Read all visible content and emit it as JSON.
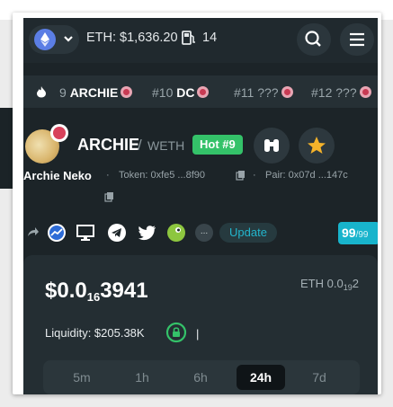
{
  "header": {
    "eth_price": "ETH: $1,636.20",
    "gas": "14"
  },
  "ticker": [
    {
      "rank": "9",
      "symbol": "ARCHIE",
      "dim": false
    },
    {
      "rank": "#10",
      "symbol": "DC",
      "dim": false
    },
    {
      "rank": "#11",
      "symbol": "???",
      "dim": true
    },
    {
      "rank": "#12",
      "symbol": "???",
      "dim": true
    }
  ],
  "token": {
    "symbol": "ARCHIE",
    "slash": "/",
    "pair": "WETH",
    "hot": "Hot #9",
    "name": "Archie Neko",
    "sep1": "·",
    "token_addr": "Token: 0xfe5 ...8f90",
    "sep2": "·",
    "pair_addr": "Pair: 0x07d ...147c"
  },
  "social": {
    "dots": "...",
    "update": "Update",
    "score": "99",
    "score_den": "/99"
  },
  "price": {
    "main_prefix": "$0.0",
    "main_sub": "16",
    "main_suffix": "3941",
    "eth_prefix": "ETH 0.0",
    "eth_sub": "19",
    "eth_suffix": "2",
    "liquidity": "Liquidity: $205.38K",
    "bar": "|"
  },
  "timeframes": [
    "5m",
    "1h",
    "6h",
    "24h",
    "7d"
  ],
  "active_timeframe": "24h",
  "colors": {
    "accent": "#18b4cc",
    "hot": "#34c269",
    "star": "#f5b32a",
    "bg": "#1c2428"
  }
}
